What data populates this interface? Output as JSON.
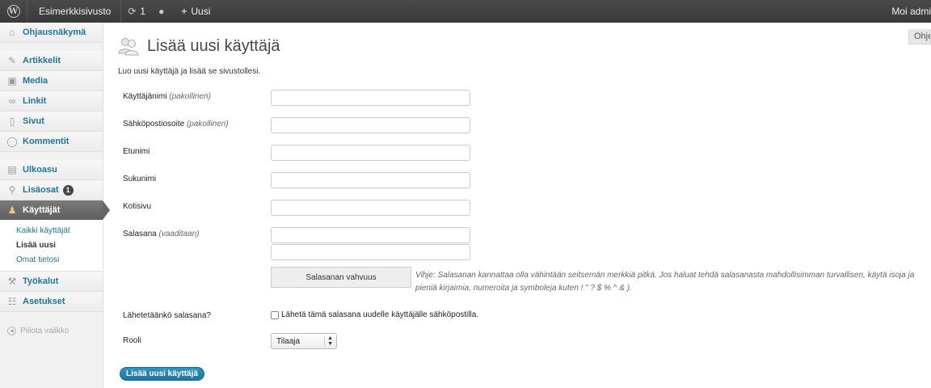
{
  "adminbar": {
    "site_name": "Esimerkkisivusto",
    "updates_count": "1",
    "new_label": "Uusi",
    "greeting": "Moi admi"
  },
  "sidebar": {
    "items": [
      {
        "label": "Ohjausnäkymä",
        "icon": "dashboard-icon"
      },
      {
        "label": "Artikkelit",
        "icon": "pin-icon"
      },
      {
        "label": "Media",
        "icon": "media-icon"
      },
      {
        "label": "Linkit",
        "icon": "link-icon"
      },
      {
        "label": "Sivut",
        "icon": "page-icon"
      },
      {
        "label": "Kommentit",
        "icon": "comment-icon"
      },
      {
        "label": "Ulkoasu",
        "icon": "appearance-icon"
      },
      {
        "label": "Lisäosat",
        "icon": "plugin-icon",
        "badge": "1"
      },
      {
        "label": "Käyttäjät",
        "icon": "users-icon"
      },
      {
        "label": "Työkalut",
        "icon": "tools-icon"
      },
      {
        "label": "Asetukset",
        "icon": "settings-icon"
      }
    ],
    "submenu": [
      "Kaikki käyttäjät",
      "Lisää uusi",
      "Omat tietosi"
    ],
    "collapse_label": "Piilota valikko"
  },
  "help_tab": "Ohje",
  "page": {
    "title": "Lisää uusi käyttäjä",
    "intro": "Luo uusi käyttäjä ja lisää se sivustollesi."
  },
  "form": {
    "username_label": "Käyttäjänimi",
    "username_note": "(pakollinen)",
    "email_label": "Sähköpostiosoite",
    "email_note": "(pakollinen)",
    "firstname_label": "Etunimi",
    "lastname_label": "Sukunimi",
    "website_label": "Kotisivu",
    "password_label": "Salasana",
    "password_note": "(vaaditaan)",
    "strength_label": "Salasanan vahvuus",
    "hint": "Vihje: Salasanan kannattaa olla vähintään seitsemän merkkiä pitkä. Jos haluat tehdä salasanasta mahdollisimman turvallisen, käytä isoja ja pieniä kirjaimia, numeroita ja symboleja kuten ! \" ? $ % ^ & ).",
    "send_password_label": "Lähetetäänkö salasana?",
    "send_password_checkbox": "Lähetä tämä salasana uudelle käyttäjälle sähköpostilla.",
    "role_label": "Rooli",
    "role_value": "Tilaaja",
    "submit_label": "Lisää uusi käyttäjä"
  }
}
